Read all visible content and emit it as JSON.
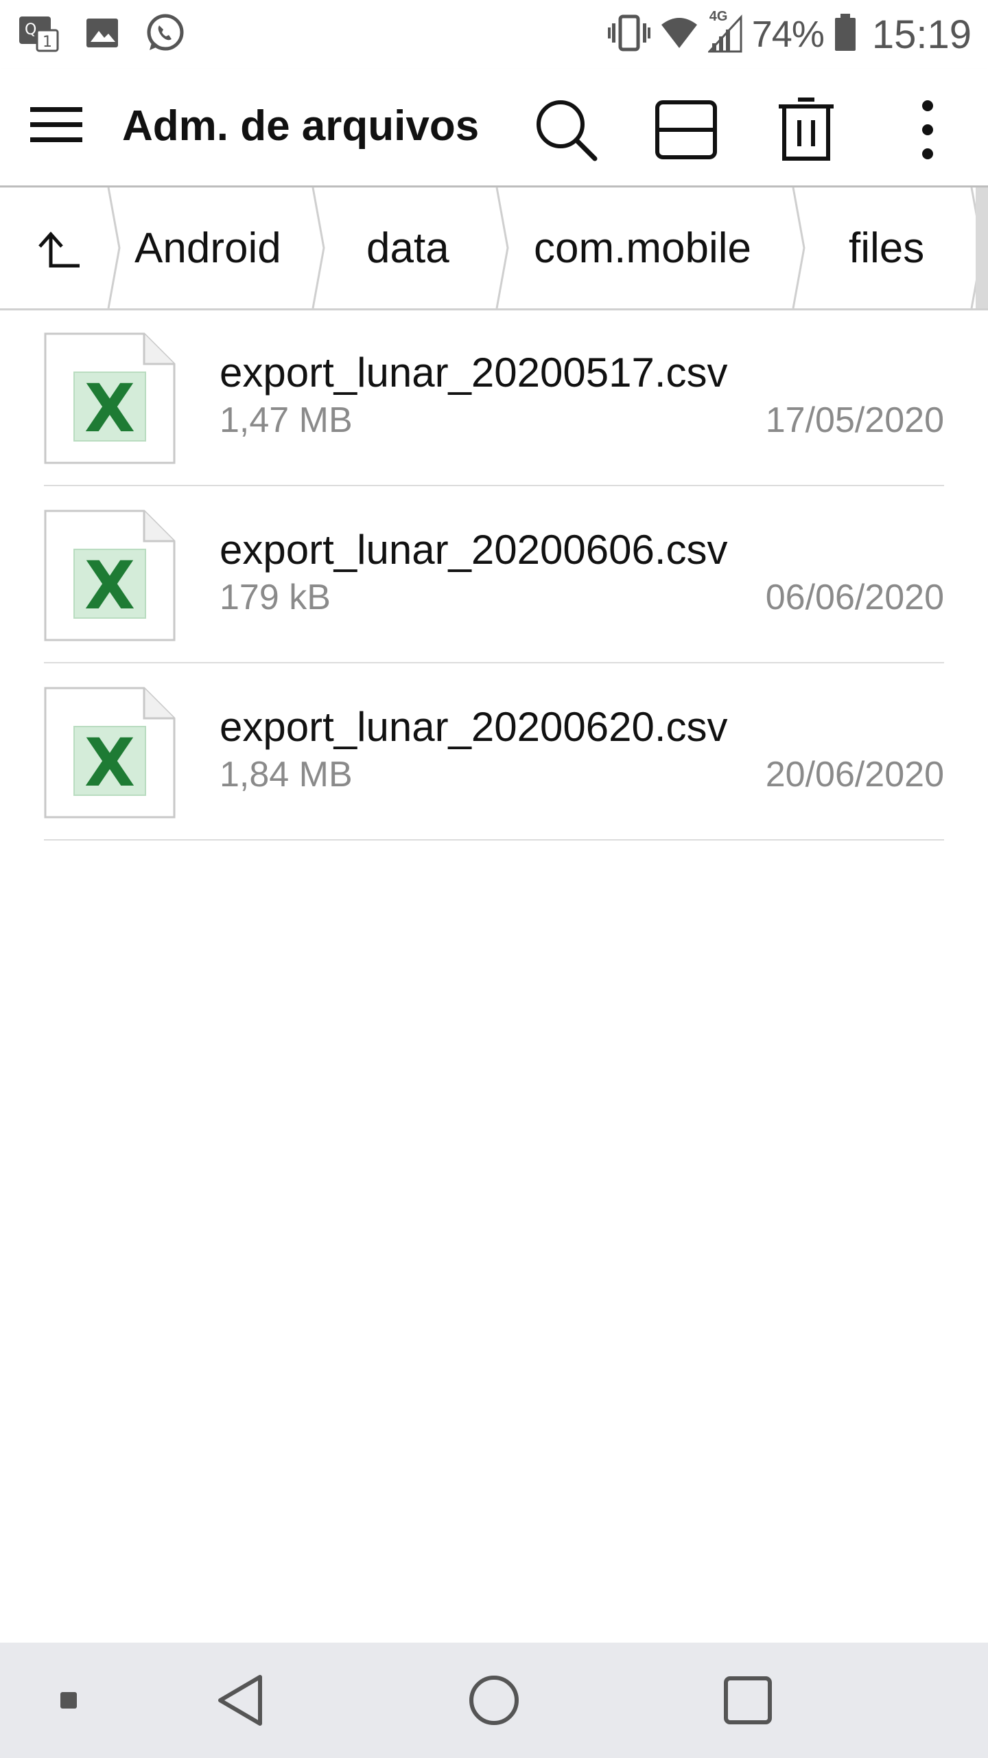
{
  "status_bar": {
    "battery_percent": "74%",
    "time": "15:19",
    "network_label": "4G",
    "left_icons": [
      "translate-badge-icon",
      "image-icon",
      "whatsapp-icon"
    ],
    "right_icons": [
      "vibrate-icon",
      "wifi-icon",
      "signal-icon",
      "battery-icon"
    ]
  },
  "app_bar": {
    "title": "Adm. de arquivos",
    "actions": [
      "search-icon",
      "view-toggle-icon",
      "delete-icon",
      "more-vert-icon"
    ]
  },
  "breadcrumb": {
    "up_icon": "arrow-up-icon",
    "items": [
      "Android",
      "data",
      "com.mobile",
      "files"
    ]
  },
  "files": [
    {
      "name": "export_lunar_20200517.csv",
      "size": "1,47 MB",
      "date": "17/05/2020",
      "icon": "excel-file-icon"
    },
    {
      "name": "export_lunar_20200606.csv",
      "size": "179 kB",
      "date": "06/06/2020",
      "icon": "excel-file-icon"
    },
    {
      "name": "export_lunar_20200620.csv",
      "size": "1,84 MB",
      "date": "20/06/2020",
      "icon": "excel-file-icon"
    }
  ],
  "nav_bar": {
    "buttons": [
      "dot-icon",
      "back-icon",
      "home-icon",
      "recents-icon"
    ]
  },
  "colors": {
    "excel_green": "#1e7b34",
    "excel_bg": "#d4ecd9",
    "secondary_text": "#8a8a8a",
    "nav_bg": "#e8e9ed"
  }
}
